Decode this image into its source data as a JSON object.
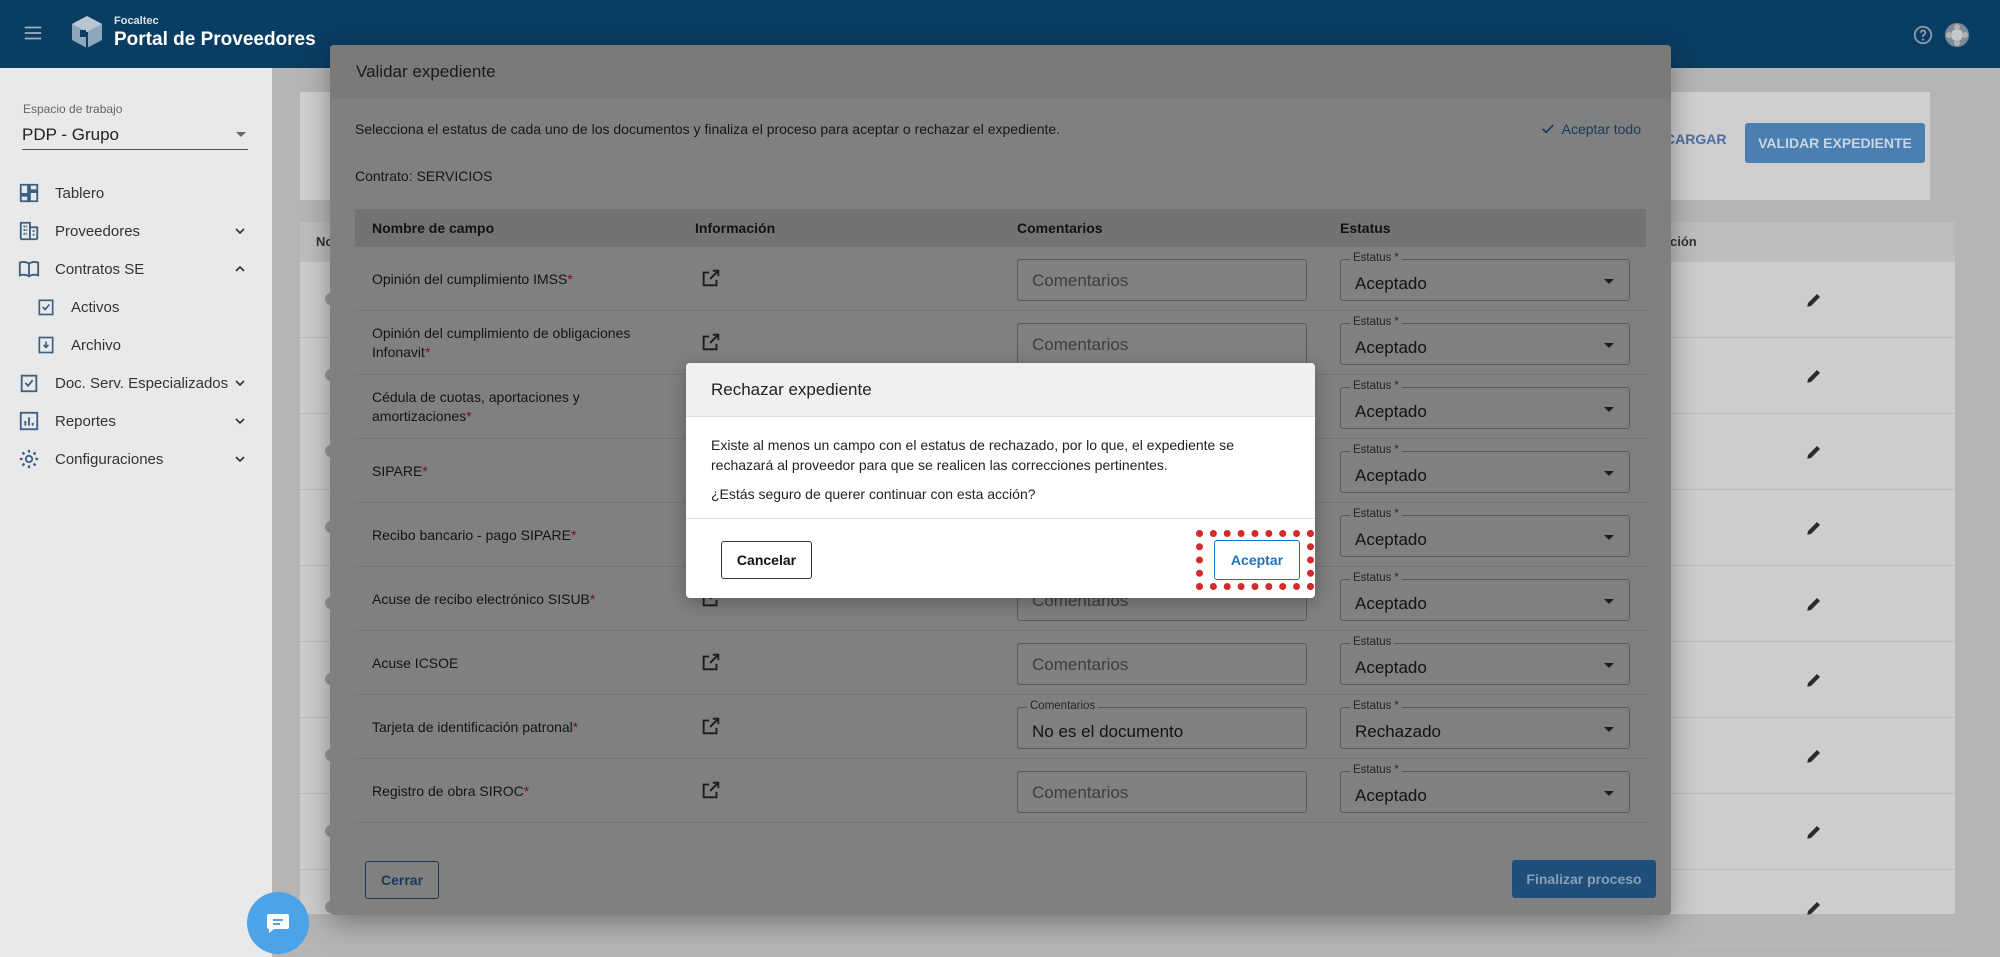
{
  "app": {
    "brand_small": "Focaltec",
    "brand_name": "Portal de Proveedores"
  },
  "sidebar": {
    "workspace_label": "Espacio de trabajo",
    "workspace_value": "PDP - Grupo",
    "items": [
      {
        "label": "Tablero",
        "icon": "dashboard-icon"
      },
      {
        "label": "Proveedores",
        "icon": "building-icon"
      },
      {
        "label": "Contratos SE",
        "icon": "book-icon"
      },
      {
        "label": "Activos",
        "icon": "checklist-icon"
      },
      {
        "label": "Archivo",
        "icon": "archive-icon"
      },
      {
        "label": "Doc. Serv. Especializados",
        "icon": "checklist-icon"
      },
      {
        "label": "Reportes",
        "icon": "chart-icon"
      },
      {
        "label": "Configuraciones",
        "icon": "gear-icon"
      }
    ]
  },
  "background": {
    "cargar_label": "CARGAR",
    "validar_label": "VALIDAR EXPEDIENTE",
    "col_left": "No",
    "col_right": "ción"
  },
  "modal": {
    "title": "Validar expediente",
    "description": "Selecciona el estatus de cada uno de los documentos y finaliza el proceso para aceptar o rechazar el expediente.",
    "accept_all": "Aceptar todo",
    "contract": "Contrato: SERVICIOS",
    "columns": {
      "name": "Nombre de campo",
      "info": "Información",
      "comments": "Comentarios",
      "status": "Estatus"
    },
    "comment_placeholder": "Comentarios",
    "rows": [
      {
        "name": "Opinión del cumplimiento IMSS",
        "required": "*",
        "comment": "",
        "status_label": "Estatus *",
        "status": "Aceptado"
      },
      {
        "name": "Opinión del cumplimiento de obligaciones Infonavit",
        "required": "*",
        "comment": "",
        "status_label": "Estatus *",
        "status": "Aceptado"
      },
      {
        "name": "Cédula de cuotas, aportaciones y amortizaciones",
        "required": "*",
        "comment": "",
        "status_label": "Estatus *",
        "status": "Aceptado"
      },
      {
        "name": "SIPARE",
        "required": "*",
        "comment": "",
        "status_label": "Estatus *",
        "status": "Aceptado"
      },
      {
        "name": "Recibo bancario - pago SIPARE",
        "required": "*",
        "comment": "",
        "status_label": "Estatus *",
        "status": "Aceptado"
      },
      {
        "name": "Acuse de recibo electrónico SISUB",
        "required": "*",
        "comment": "",
        "status_label": "Estatus *",
        "status": "Aceptado"
      },
      {
        "name": "Acuse ICSOE",
        "required": "",
        "comment": "",
        "status_label": "Estatus",
        "status": "Aceptado"
      },
      {
        "name": "Tarjeta de identificación patronal",
        "required": "*",
        "comment_label": "Comentarios",
        "comment": "No es el documento",
        "status_label": "Estatus *",
        "status": "Rechazado"
      },
      {
        "name": "Registro de obra SIROC",
        "required": "*",
        "comment": "",
        "status_label": "Estatus *",
        "status": "Aceptado"
      }
    ],
    "close_label": "Cerrar",
    "finish_label": "Finalizar proceso"
  },
  "dialog": {
    "title": "Rechazar expediente",
    "message1": "Existe al menos un campo con el estatus de rechazado, por lo que, el expediente se rechazará al proveedor para que se realicen las correcciones pertinentes.",
    "message2": "¿Estás seguro de querer continuar con esta acción?",
    "cancel_label": "Cancelar",
    "accept_label": "Aceptar"
  },
  "colors": {
    "topbar": "#0a3d62",
    "accent": "#1c73c4",
    "highlight": "#d42a2a",
    "fab": "#4da3e8"
  }
}
